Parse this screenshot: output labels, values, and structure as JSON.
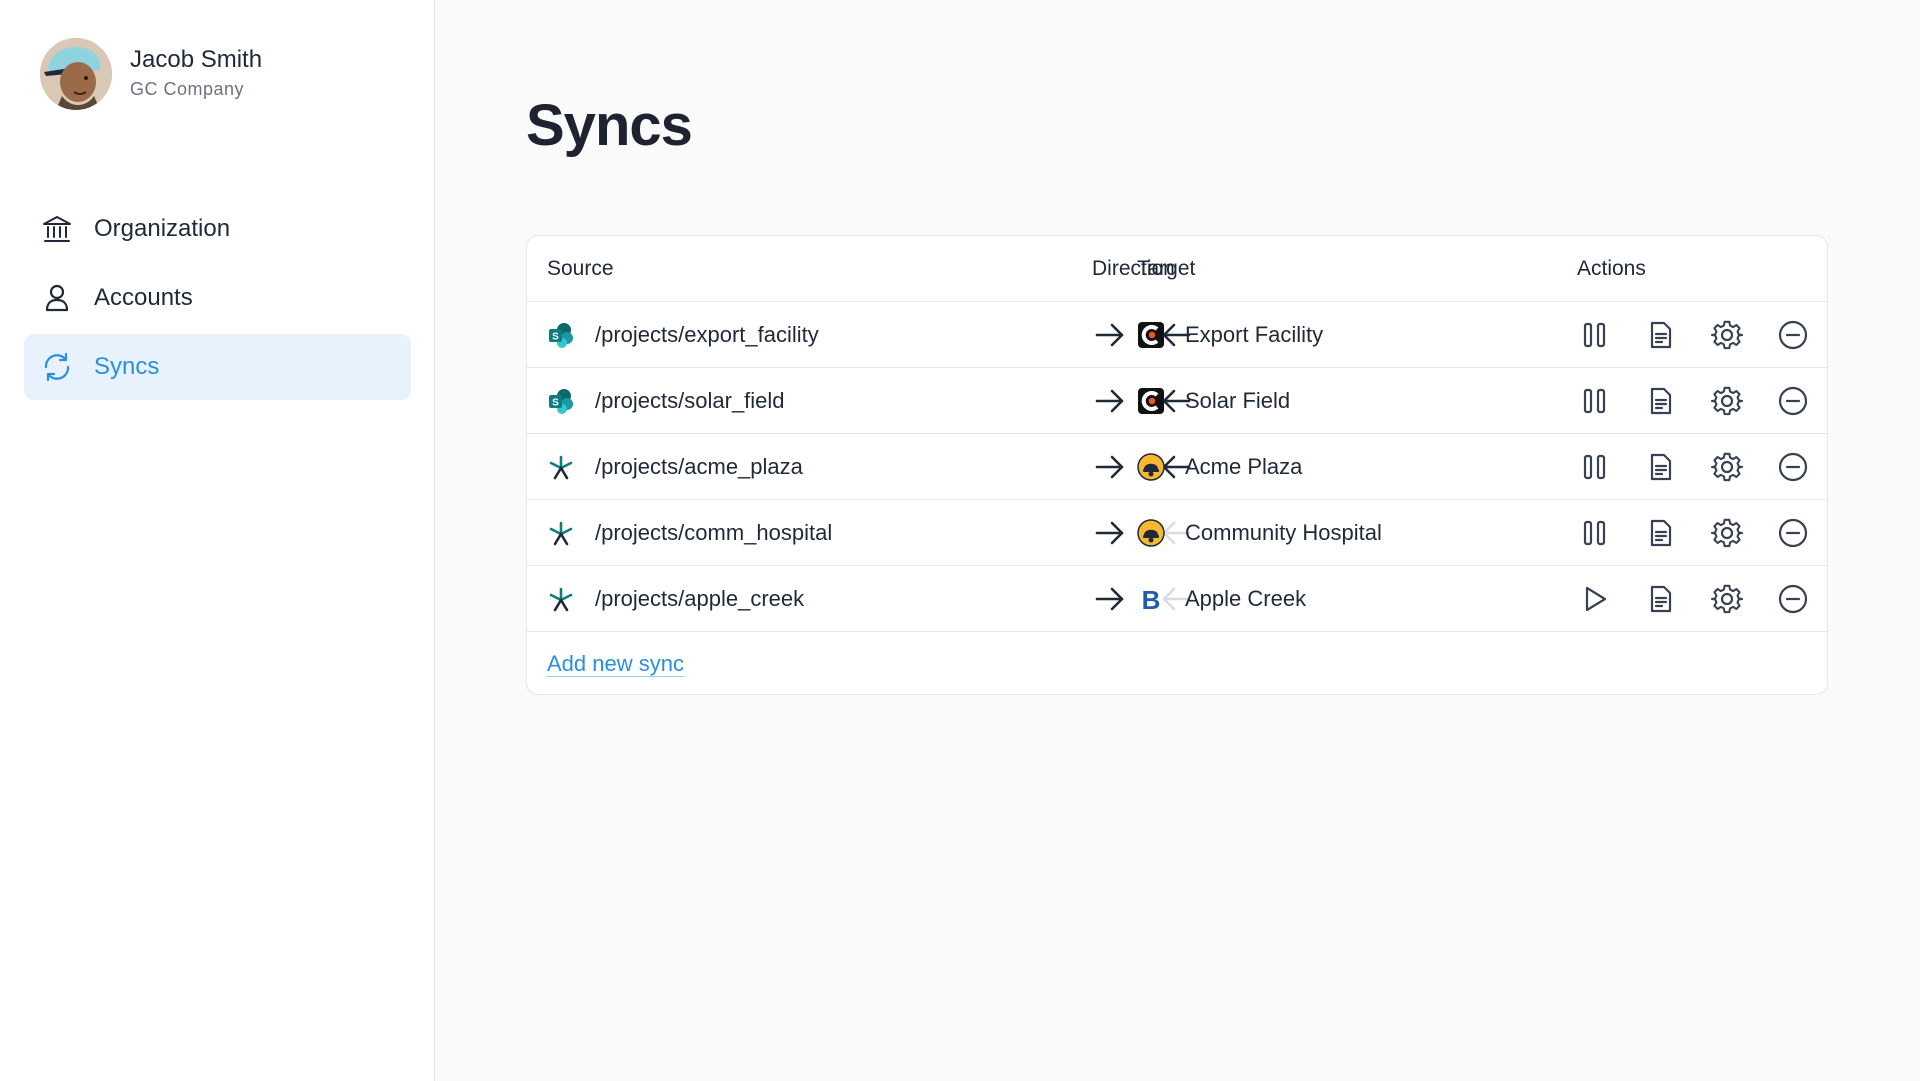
{
  "user": {
    "name": "Jacob Smith",
    "company": "GC Company"
  },
  "nav": {
    "items": [
      {
        "label": "Organization",
        "icon": "bank-icon"
      },
      {
        "label": "Accounts",
        "icon": "user-icon"
      },
      {
        "label": "Syncs",
        "icon": "sync-icon",
        "active": true
      }
    ]
  },
  "page": {
    "title": "Syncs"
  },
  "table": {
    "headers": {
      "source": "Source",
      "direction": "Direction",
      "target": "Target",
      "actions": "Actions"
    },
    "rows": [
      {
        "source": "/projects/export_facility",
        "source_icon": "sharepoint-icon",
        "forward": true,
        "backward": true,
        "target": "Export Facility",
        "target_icon": "procore-icon",
        "state": "pause-icon"
      },
      {
        "source": "/projects/solar_field",
        "source_icon": "sharepoint-icon",
        "forward": true,
        "backward": true,
        "target": "Solar Field",
        "target_icon": "procore-icon",
        "state": "pause-icon"
      },
      {
        "source": "/projects/acme_plaza",
        "source_icon": "autodesk-icon",
        "forward": true,
        "backward": true,
        "target": "Acme Plaza",
        "target_icon": "hardhat-icon",
        "state": "pause-icon"
      },
      {
        "source": "/projects/comm_hospital",
        "source_icon": "autodesk-icon",
        "forward": true,
        "backward": false,
        "target": "Community Hospital",
        "target_icon": "hardhat-icon",
        "state": "pause-icon"
      },
      {
        "source": "/projects/apple_creek",
        "source_icon": "autodesk-icon",
        "forward": true,
        "backward": false,
        "target": "Apple Creek",
        "target_icon": "bluebeam-icon",
        "state": "play-icon"
      }
    ],
    "add_label": "Add new sync"
  },
  "colors": {
    "accent": "#2b8fde",
    "active_bg": "#e7f2fc",
    "sharepoint": "#0f7c80",
    "procore": "#f05a22",
    "hardhat": "#f5b82e",
    "bluebeam": "#1f5fa8"
  }
}
